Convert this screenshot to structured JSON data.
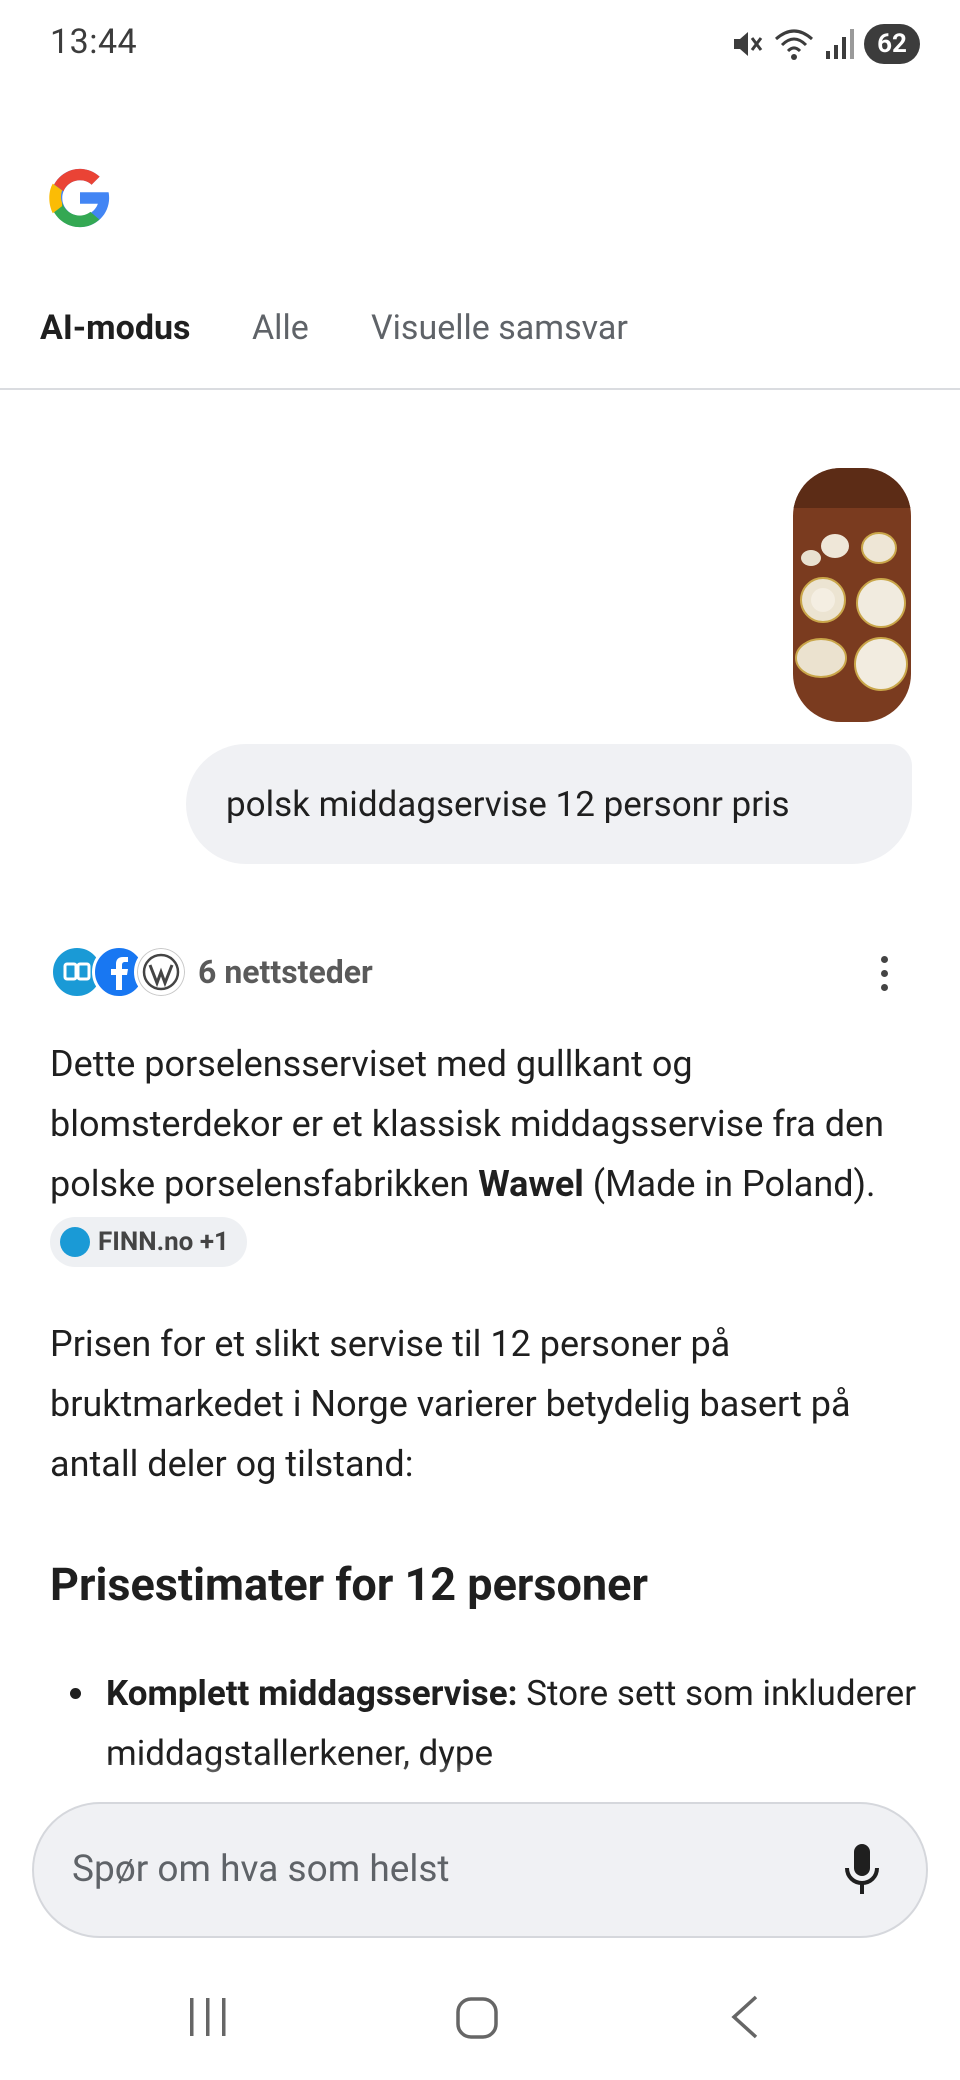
{
  "status_bar": {
    "time": "13:44",
    "battery": "62",
    "icons": [
      "mute-icon",
      "wifi-6e-icon",
      "signal-icon",
      "battery-icon"
    ]
  },
  "brand": {
    "logo": "google-logo"
  },
  "tabs": [
    {
      "label": "AI-modus",
      "active": true
    },
    {
      "label": "Alle",
      "active": false
    },
    {
      "label": "Visuelle samsvar",
      "active": false
    }
  ],
  "query": {
    "text": "polsk middagservise 12 personr pris"
  },
  "sources": {
    "label": "6 nettsteder",
    "icons": [
      "finn-icon",
      "facebook-icon",
      "wordpress-icon"
    ]
  },
  "answer": {
    "p1_before": "Dette porselensserviset med gullkant og blomsterdekor er et klassisk middagsservise fra den polske porselensfabrikken ",
    "p1_bold": "Wawel",
    "p1_after": " (Made in Poland).",
    "chip_label": "FINN.no +1",
    "p2": "Prisen for et slikt servise til 12 personer på bruktmarkedet i Norge varierer betydelig basert på antall deler og tilstand:",
    "heading": "Prisestimater for 12 personer",
    "bullet_bold": "Komplett middagsservise:",
    "bullet_text": " Store sett som inkluderer middagstallerkener, dype"
  },
  "search": {
    "placeholder": "Spør om hva som helst"
  },
  "nav": [
    "recents-icon",
    "home-icon",
    "back-icon"
  ],
  "colors": {
    "accent_blue": "#4285f4",
    "accent_red": "#ea4335",
    "accent_yellow": "#fbbc05",
    "accent_green": "#34a853",
    "bubble_bg": "#f0f1f4",
    "text": "#1f1f1f",
    "muted": "#5f6368"
  }
}
